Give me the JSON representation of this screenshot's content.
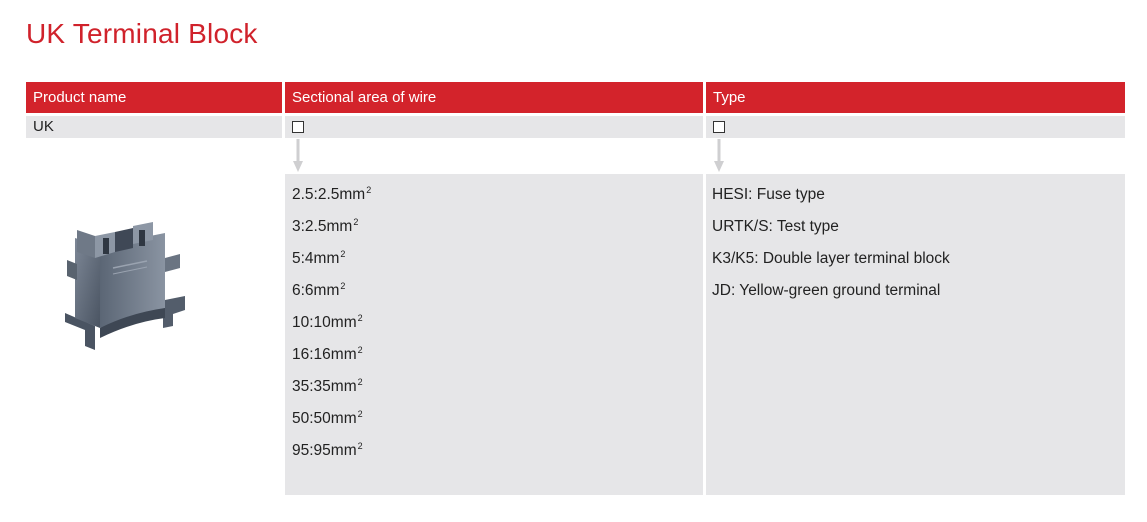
{
  "page": {
    "title": "UK Terminal Block"
  },
  "table": {
    "headers": [
      "Product name",
      "Sectional area of wire",
      "Type"
    ],
    "product_row": {
      "name": "UK"
    }
  },
  "wire_sizes": [
    {
      "label": "2.5:2.5mm",
      "sup": "2"
    },
    {
      "label": "3:2.5mm",
      "sup": "2"
    },
    {
      "label": "5:4mm",
      "sup": "2"
    },
    {
      "label": "6:6mm",
      "sup": "2"
    },
    {
      "label": "10:10mm",
      "sup": "2"
    },
    {
      "label": "16:16mm",
      "sup": "2"
    },
    {
      "label": "35:35mm",
      "sup": "2"
    },
    {
      "label": "50:50mm",
      "sup": "2"
    },
    {
      "label": "95:95mm",
      "sup": "2"
    }
  ],
  "types": [
    "HESI: Fuse type",
    "URTK/S: Test type",
    "K3/K5: Double layer terminal block",
    "JD: Yellow-green ground terminal"
  ],
  "colors": {
    "accent": "#d3232b",
    "title": "#d0222b",
    "panel": "#e6e6e8"
  },
  "icons": {
    "product_image": "terminal-block-illustration",
    "checkbox": "empty-square",
    "arrow": "down-arrow"
  }
}
